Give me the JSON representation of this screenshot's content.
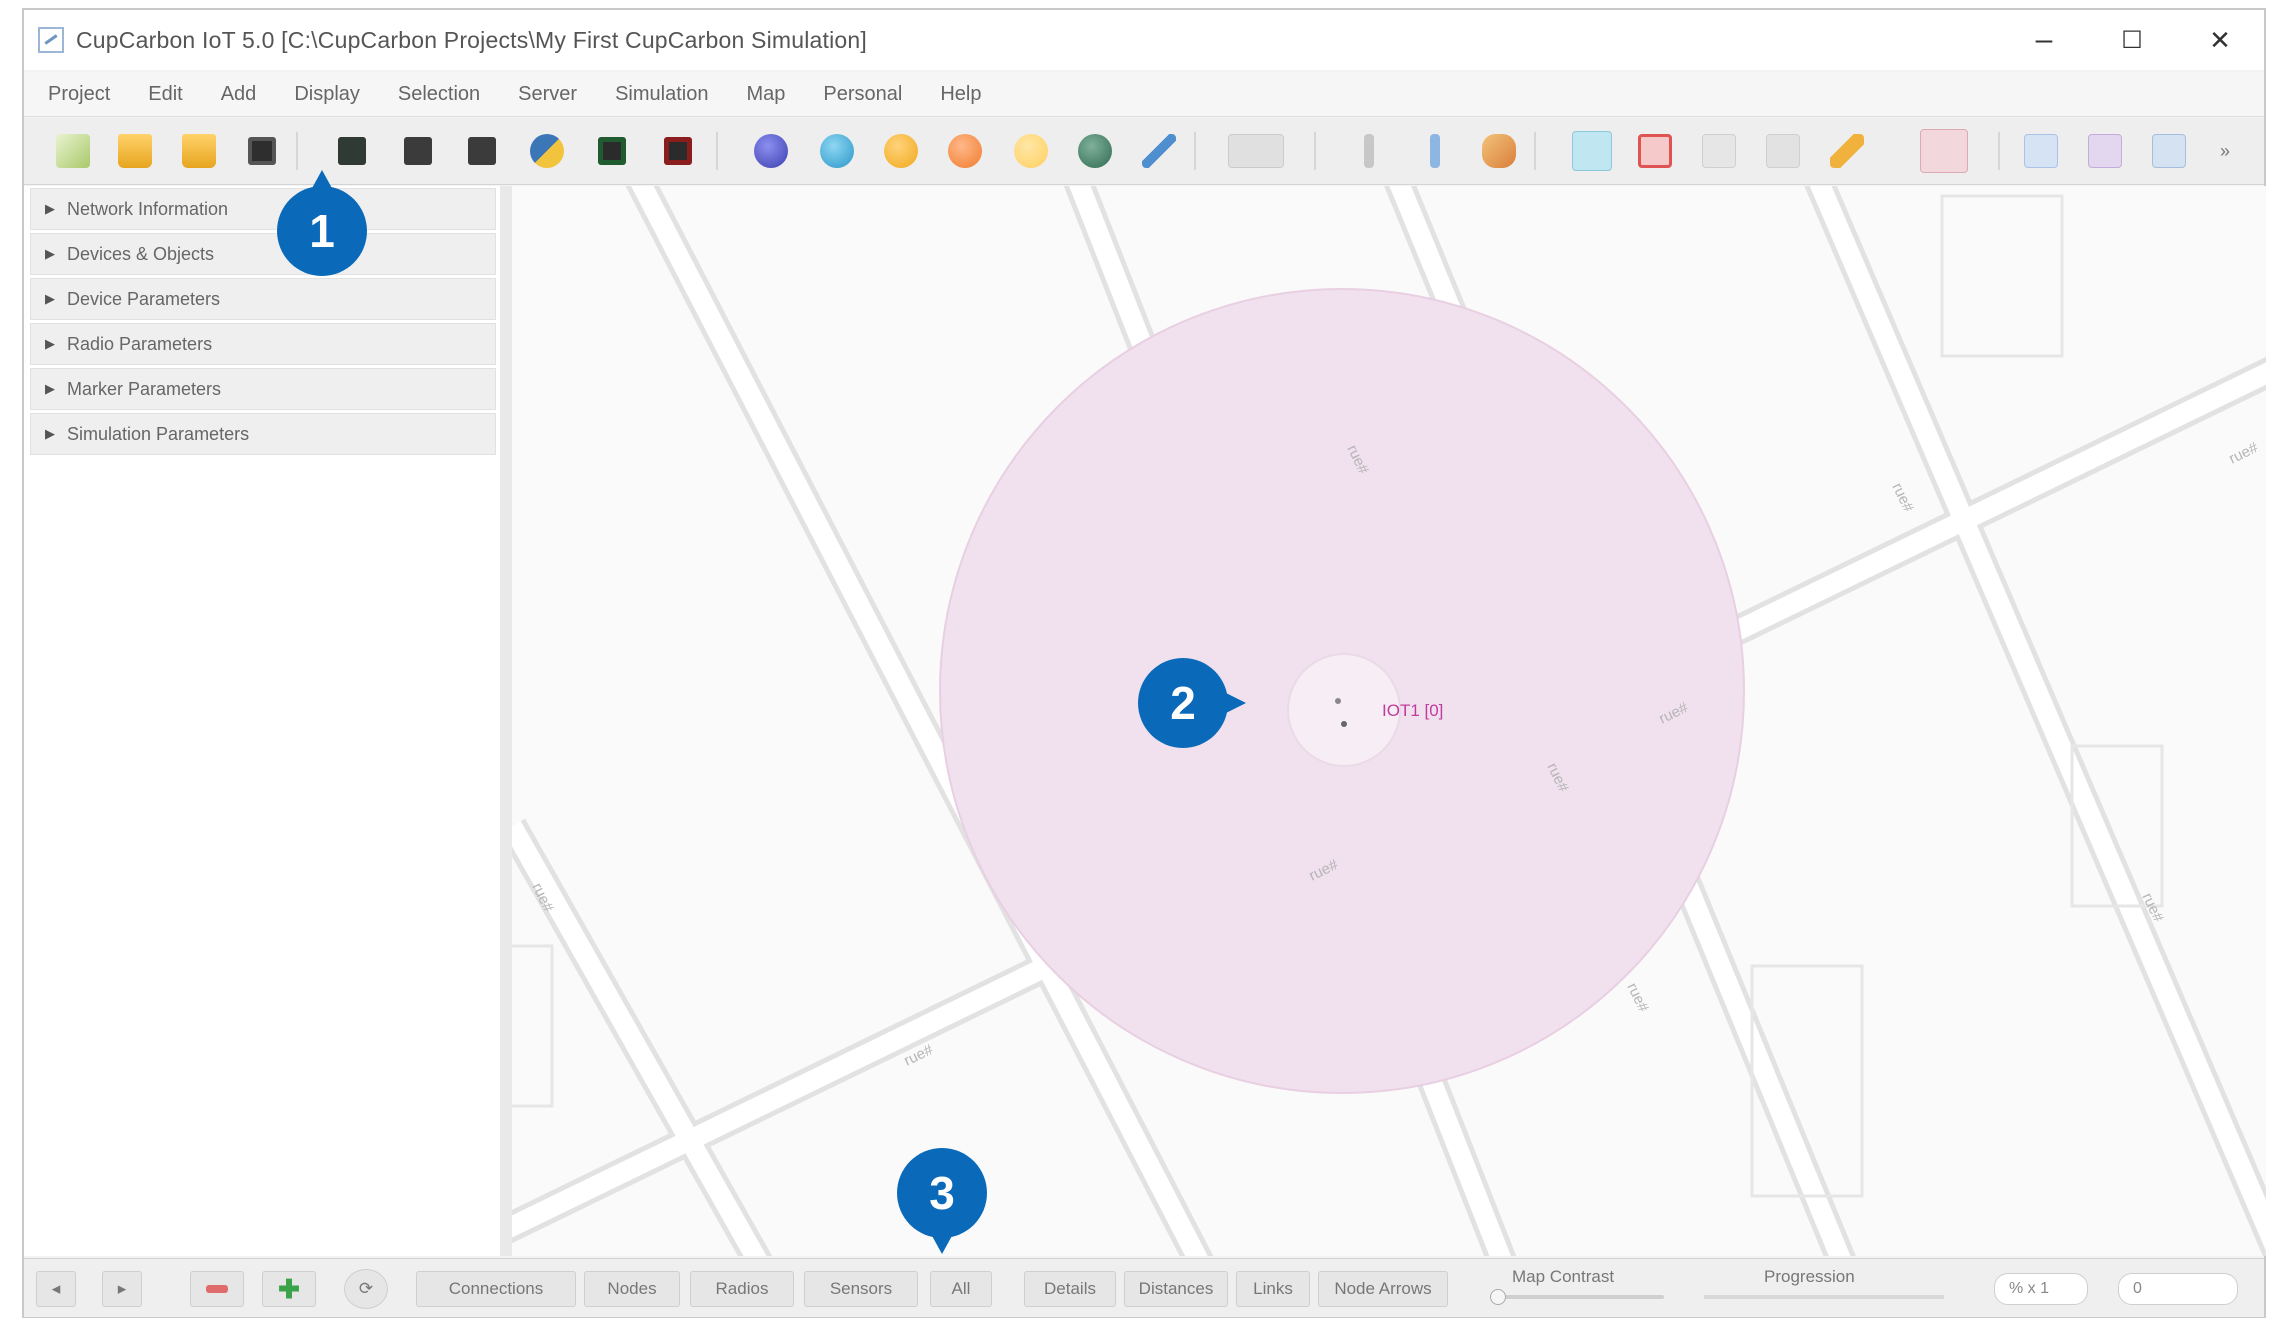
{
  "window": {
    "title": "CupCarbon IoT 5.0 [C:\\CupCarbon Projects\\My First CupCarbon Simulation]",
    "minimize": "–",
    "maximize": "☐",
    "close": "✕"
  },
  "menu": [
    "Project",
    "Edit",
    "Add",
    "Display",
    "Selection",
    "Server",
    "Simulation",
    "Map",
    "Personal",
    "Help"
  ],
  "sidebar": {
    "panels": [
      "Network Information",
      "Devices & Objects",
      "Device Parameters",
      "Radio Parameters",
      "Marker Parameters",
      "Simulation Parameters"
    ]
  },
  "map": {
    "node_label": "IOT1 [0]",
    "street_label": "rue#"
  },
  "callouts": [
    "1",
    "2",
    "3"
  ],
  "statusbar": {
    "buttons": [
      "Connections",
      "Nodes",
      "Radios",
      "Sensors",
      "All",
      "Details",
      "Distances",
      "Links",
      "Node Arrows"
    ],
    "map_contrast": "Map Contrast",
    "progression": "Progression",
    "zoom_field": "% x 1",
    "field_value": "0"
  },
  "colors": {
    "callout": "#0a69b8",
    "radio_range": "#f1e1ee",
    "node_label": "#c03b9e",
    "toolbar_active": "#bfe6f1"
  },
  "icons": {
    "toolbar": [
      "new-project-icon",
      "open-folder-icon",
      "open-recent-icon",
      "save-icon",
      "view-icon",
      "view-icon",
      "view-icon",
      "python-icon",
      "start-icon",
      "stop-icon",
      "sensor-node-icon",
      "base-station-icon",
      "mobile-icon",
      "gas-icon",
      "marker-icon",
      "router-icon",
      "route-icon",
      "grid-icon",
      "marker-line-icon",
      "marker-line-icon",
      "link-icon",
      "play-icon",
      "record-icon",
      "chart-icon",
      "edit-icon",
      "pencil-icon",
      "heart-icon",
      "undo-icon",
      "columns-icon",
      "layout-icon",
      "more-icon"
    ]
  }
}
